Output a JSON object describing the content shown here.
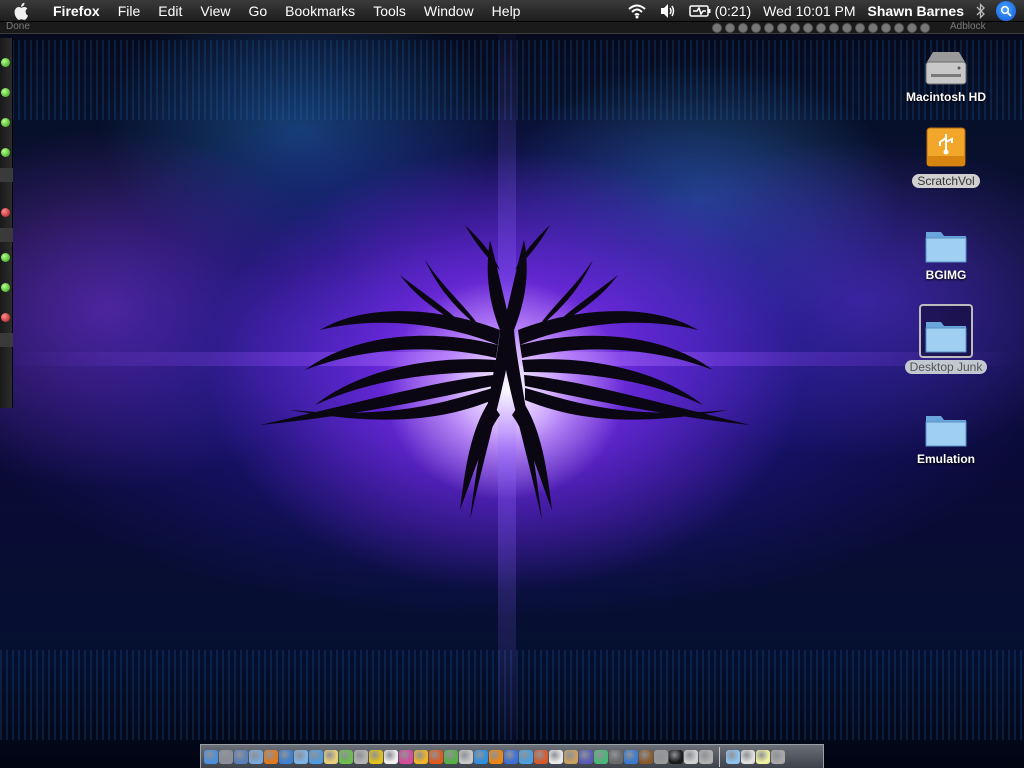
{
  "menubar": {
    "app_name": "Firefox",
    "items": [
      "File",
      "Edit",
      "View",
      "Go",
      "Bookmarks",
      "Tools",
      "Window",
      "Help"
    ],
    "battery_time": "(0:21)",
    "clock": "Wed 10:01 PM",
    "user": "Shawn Barnes"
  },
  "firefox_status": {
    "status_text": "Done",
    "adblock_label": "Adblock"
  },
  "desktop_icons": [
    {
      "label": "Macintosh HD",
      "icon": "hard-drive-icon"
    },
    {
      "label": "ScratchVol",
      "icon": "usb-drive-icon"
    },
    {
      "label": "BGIMG",
      "icon": "folder-icon"
    },
    {
      "label": "Desktop Junk",
      "icon": "folder-icon"
    },
    {
      "label": "Emulation",
      "icon": "folder-icon"
    }
  ],
  "colors": {
    "menubar": "#262626",
    "selection_label": "#d0d0d0",
    "folder_blue": "#8ec3ee",
    "usb_orange": "#f2a62a",
    "led_green": "#46c21e",
    "led_red": "#d2242a"
  },
  "dock": {
    "apps": [
      {
        "name": "finder",
        "color": "#4b8fdc"
      },
      {
        "name": "system-prefs",
        "color": "#8a8f99"
      },
      {
        "name": "preview",
        "color": "#5a7fb8"
      },
      {
        "name": "network",
        "color": "#7aa8d8"
      },
      {
        "name": "firefox",
        "color": "#e07a1e"
      },
      {
        "name": "finder-2",
        "color": "#3d7fd0"
      },
      {
        "name": "mail",
        "color": "#7fb3e6"
      },
      {
        "name": "ichat",
        "color": "#4f9de0"
      },
      {
        "name": "notes",
        "color": "#e8d07a"
      },
      {
        "name": "bittorrent",
        "color": "#6bbf4a"
      },
      {
        "name": "headphones",
        "color": "#b4b4b4"
      },
      {
        "name": "disc",
        "color": "#e2c21a"
      },
      {
        "name": "star",
        "color": "#f0f0f0"
      },
      {
        "name": "flower",
        "color": "#d84a9a"
      },
      {
        "name": "pencil",
        "color": "#f0b428"
      },
      {
        "name": "transmit",
        "color": "#e05a1e"
      },
      {
        "name": "maps",
        "color": "#58b048"
      },
      {
        "name": "script",
        "color": "#c8c8c8"
      },
      {
        "name": "safari",
        "color": "#2f8fe0"
      },
      {
        "name": "vlc",
        "color": "#ee8812"
      },
      {
        "name": "clapper",
        "color": "#3d6fd8"
      },
      {
        "name": "network-2",
        "color": "#4aa0e0"
      },
      {
        "name": "paint",
        "color": "#d85a2a"
      },
      {
        "name": "calendar",
        "color": "#e8e8e8"
      },
      {
        "name": "addressbook",
        "color": "#c8a060"
      },
      {
        "name": "nvu",
        "color": "#5a5ab8"
      },
      {
        "name": "games",
        "color": "#4ab878"
      },
      {
        "name": "pin",
        "color": "#6a6a6a"
      },
      {
        "name": "camera",
        "color": "#3a7ad0"
      },
      {
        "name": "guitar",
        "color": "#8a5a2a"
      },
      {
        "name": "utilities",
        "color": "#9a9a9a"
      },
      {
        "name": "terminal",
        "color": "#1a1a1a"
      },
      {
        "name": "photo",
        "color": "#d0d0d0"
      },
      {
        "name": "scanner",
        "color": "#b0b0b0"
      }
    ],
    "docs": [
      {
        "name": "folder",
        "color": "#8ec3ee"
      },
      {
        "name": "home",
        "color": "#e0e0e0"
      },
      {
        "name": "lightbulb",
        "color": "#f0f0a0"
      },
      {
        "name": "trash",
        "color": "#a8a8a8"
      }
    ]
  }
}
